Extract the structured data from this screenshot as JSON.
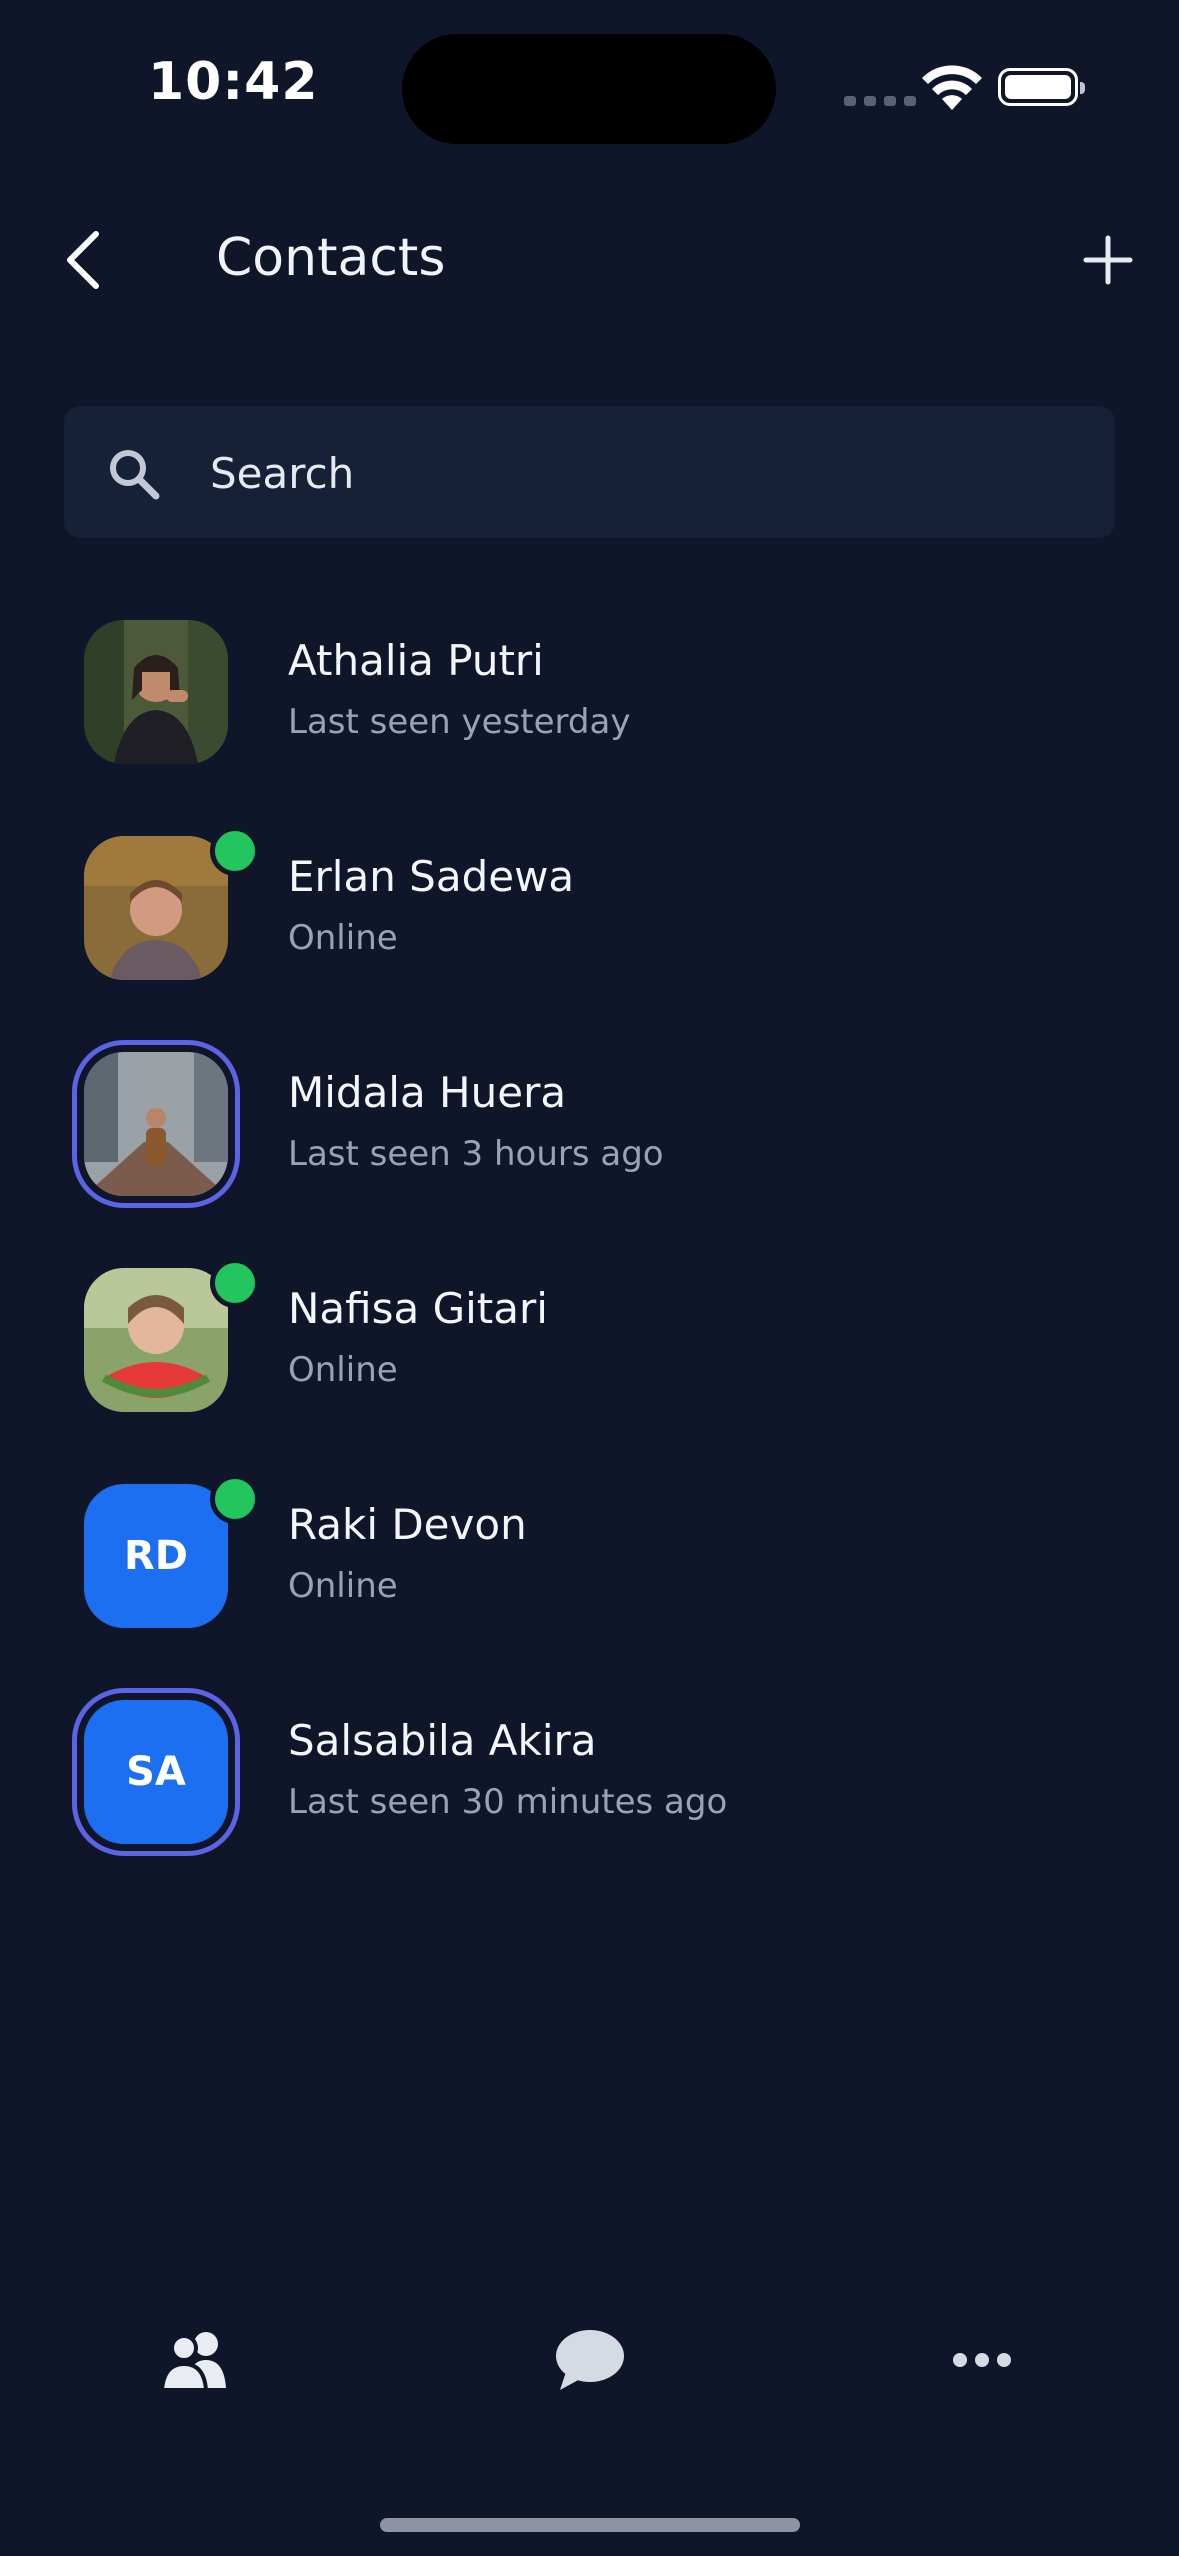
{
  "status_bar": {
    "time": "10:42"
  },
  "header": {
    "title": "Contacts",
    "back_icon": "chevron-left-icon",
    "add_icon": "plus-icon"
  },
  "search": {
    "placeholder": "Search",
    "value": "",
    "icon": "search-icon"
  },
  "contacts": [
    {
      "name": "Athalia Putri",
      "status": "Last seen yesterday",
      "online": false,
      "ring": false
    },
    {
      "name": "Erlan Sadewa",
      "status": "Online",
      "online": true,
      "ring": false
    },
    {
      "name": "Midala Huera",
      "status": "Last seen 3 hours ago",
      "online": false,
      "ring": true
    },
    {
      "name": "Nafisa Gitari",
      "status": "Online",
      "online": true,
      "ring": false
    },
    {
      "name": "Raki Devon",
      "status": "Online",
      "online": true,
      "ring": false,
      "initials": "RD"
    },
    {
      "name": "Salsabila Akira",
      "status": "Last seen 30 minutes ago",
      "online": false,
      "ring": true,
      "initials": "SA"
    }
  ],
  "tabs": [
    {
      "icon": "contacts-icon",
      "active": true
    },
    {
      "icon": "chat-icon",
      "active": false
    },
    {
      "icon": "more-icon",
      "active": false
    }
  ],
  "colors": {
    "background": "#0f1629",
    "search_bg": "#162036",
    "initials_avatar": "#1d6ff2",
    "online": "#22c55e",
    "story_ring": "#5b63e6",
    "secondary_text": "#9aa3b5"
  }
}
